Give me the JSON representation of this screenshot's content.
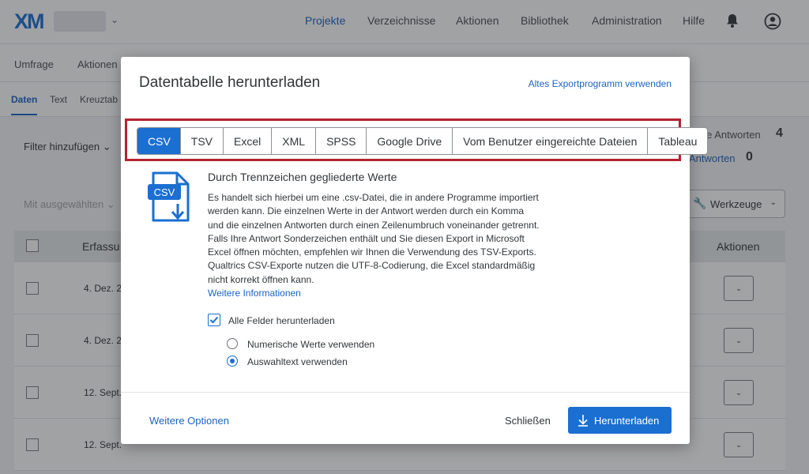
{
  "app": {
    "logo": "XM",
    "nav": [
      "Projekte",
      "Verzeichnisse",
      "Aktionen",
      "Bibliothek",
      "Administration",
      "Hilfe"
    ],
    "subnav": [
      "Umfrage",
      "Aktionen"
    ],
    "tabs": [
      "Daten",
      "Text",
      "Kreuztab"
    ]
  },
  "toolbar": {
    "filter": "Filter hinzufügen",
    "with_selected": "Mit ausgewählten",
    "stat1_label": "nete Antworten",
    "stat1_value": "4",
    "stat2_label": "Antworten",
    "stat2_value": "0",
    "tools": "Werkzeuge"
  },
  "table": {
    "col_date": "Erfassu",
    "col_actions": "Aktionen",
    "rows": [
      "4. Dez. 2",
      "4. Dez. 2",
      "12. Sept.",
      "12. Sept."
    ]
  },
  "modal": {
    "title": "Datentabelle herunterladen",
    "legacy_link": "Altes Exportprogramm verwenden",
    "formats": [
      "CSV",
      "TSV",
      "Excel",
      "XML",
      "SPSS",
      "Google Drive",
      "Vom Benutzer eingereichte Dateien",
      "Tableau"
    ],
    "selected_format": "CSV",
    "icon_label": "CSV",
    "section_title": "Durch Trennzeichen gegliederte Werte",
    "description": "Es handelt sich hierbei um eine .csv-Datei, die in andere Programme importiert werden kann. Die einzelnen Werte in der Antwort werden durch ein Komma und die einzelnen Antworten durch einen Zeilenumbruch voneinander getrennt. Falls Ihre Antwort Sonderzeichen enthält und Sie diesen Export in Microsoft Excel öffnen möchten, empfehlen wir Ihnen die Verwendung des TSV-Exports. Qualtrics CSV-Exporte nutzen die UTF-8-Codierung, die Excel standardmäßig nicht korrekt öffnen kann.",
    "more_info": "Weitere Informationen",
    "checkbox_label": "Alle Felder herunterladen",
    "checkbox_checked": true,
    "radio_numeric": "Numerische Werte verwenden",
    "radio_text": "Auswahltext verwenden",
    "radio_selected": "Auswahltext verwenden",
    "footer": {
      "more_options": "Weitere Optionen",
      "close": "Schließen",
      "download": "Herunterladen"
    }
  },
  "colors": {
    "accent": "#1b6fd1",
    "highlight": "#b3232f"
  }
}
